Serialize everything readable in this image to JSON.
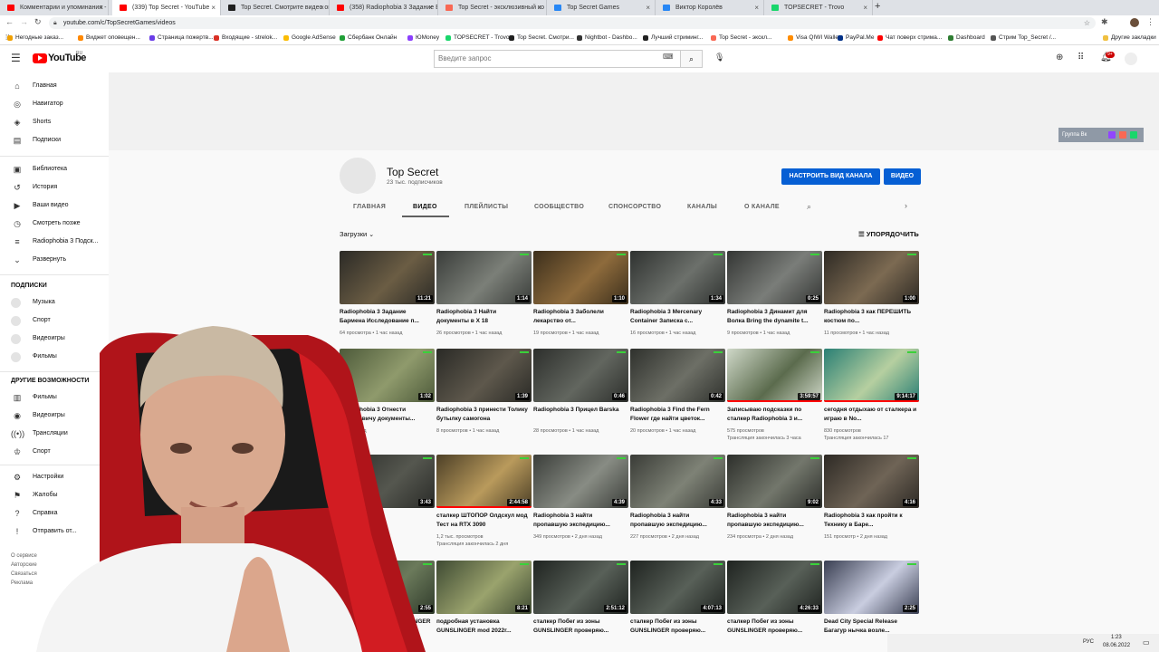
{
  "browser": {
    "tabs": [
      {
        "title": "Комментарии и упоминания -",
        "color": "#ff0000"
      },
      {
        "title": "(339) Top Secret - YouTube",
        "color": "#ff0000"
      },
      {
        "title": "Top Secret. Смотрите видео он",
        "color": "#1f1f1f"
      },
      {
        "title": "(358) Radiophobia 3 Задание Б",
        "color": "#ff0000"
      },
      {
        "title": "Top Secret - эксклюзивный ко",
        "color": "#f96854"
      },
      {
        "title": "Top Secret Games",
        "color": "#2787f5"
      },
      {
        "title": "Виктор Королёв",
        "color": "#2787f5"
      },
      {
        "title": "TOPSECRET - Trovo",
        "color": "#19d66b"
      }
    ],
    "new_tab": "+",
    "url": "youtube.com/c/TopSecretGames/videos",
    "bookmarks": [
      {
        "label": "Негодные заказ...",
        "color": "#f0a000"
      },
      {
        "label": "Виджет оповещен...",
        "color": "#ff8800"
      },
      {
        "label": "Страница пожертв...",
        "color": "#6a3de8"
      },
      {
        "label": "Входящие - strelok...",
        "color": "#d93025"
      },
      {
        "label": "Google AdSense",
        "color": "#fbbc04"
      },
      {
        "label": "Сбербанк Онлайн",
        "color": "#21a038"
      },
      {
        "label": "ЮMoney",
        "color": "#8b3ffd"
      },
      {
        "label": "TOPSECRET - Trovo",
        "color": "#19d66b"
      },
      {
        "label": "Top Secret. Смотри...",
        "color": "#1f1f1f"
      },
      {
        "label": "Nightbot - Dashbo...",
        "color": "#333"
      },
      {
        "label": "Лучший стриминг...",
        "color": "#222"
      },
      {
        "label": "Top Secret - экскл...",
        "color": "#f96854"
      },
      {
        "label": "Visa QIWI Wallet",
        "color": "#ff8c00"
      },
      {
        "label": "PayPal.Me",
        "color": "#003087"
      },
      {
        "label": "Чат поверх стрима...",
        "color": "#ff0000"
      },
      {
        "label": "Dashboard",
        "color": "#2e7d32"
      },
      {
        "label": "Стрим Top_Secret /...",
        "color": "#555"
      }
    ],
    "other_bookmarks": "Другие закладки"
  },
  "youtube": {
    "logo": "YouTube",
    "logo_sup": "RU",
    "search_placeholder": "Введите запрос",
    "notif_count": "9+"
  },
  "sidebar": {
    "main": [
      {
        "label": "Главная",
        "icon": "home-icon",
        "glyph": "⌂"
      },
      {
        "label": "Навигатор",
        "icon": "compass-icon",
        "glyph": "◎"
      },
      {
        "label": "Shorts",
        "icon": "shorts-icon",
        "glyph": "◈"
      },
      {
        "label": "Подписки",
        "icon": "subscriptions-icon",
        "glyph": "▤"
      }
    ],
    "library": [
      {
        "label": "Библиотека",
        "icon": "library-icon",
        "glyph": "▣"
      },
      {
        "label": "История",
        "icon": "history-icon",
        "glyph": "↺"
      },
      {
        "label": "Ваши видео",
        "icon": "your-videos-icon",
        "glyph": "▶"
      },
      {
        "label": "Смотреть позже",
        "icon": "watch-later-icon",
        "glyph": "◷"
      },
      {
        "label": "Radiophobia 3 Подск...",
        "icon": "playlist-icon",
        "glyph": "≡"
      },
      {
        "label": "Развернуть",
        "icon": "chevron-down-icon",
        "glyph": "⌄"
      }
    ],
    "subs_heading": "ПОДПИСКИ",
    "subs": [
      "Музыка",
      "Спорт",
      "Видеоигры",
      "Фильмы"
    ],
    "more_heading": "ДРУГИЕ ВОЗМОЖНОСТИ",
    "more": [
      {
        "label": "Фильмы",
        "icon": "movies-icon",
        "glyph": "▥"
      },
      {
        "label": "Видеоигры",
        "icon": "gaming-icon",
        "glyph": "◉"
      },
      {
        "label": "Трансляции",
        "icon": "live-icon",
        "glyph": "((•))"
      },
      {
        "label": "Спорт",
        "icon": "sports-icon",
        "glyph": "♔"
      }
    ],
    "settings": [
      {
        "label": "Настройки",
        "icon": "gear-icon",
        "glyph": "⚙"
      },
      {
        "label": "Жалобы",
        "icon": "flag-icon",
        "glyph": "⚑"
      },
      {
        "label": "Справка",
        "icon": "help-icon",
        "glyph": "?"
      },
      {
        "label": "Отправить от...",
        "icon": "feedback-icon",
        "glyph": "!"
      }
    ],
    "footer": [
      "О сервисе",
      "Авторские",
      "Связаться",
      "Реклама"
    ]
  },
  "banner": {
    "links_label": "Группа Вк"
  },
  "channel": {
    "name": "Top Secret",
    "subscribers": "23 тыс. подписчиков",
    "customize_button": "НАСТРОИТЬ ВИД КАНАЛА",
    "video_button": "ВИДЕО",
    "tabs": [
      "ГЛАВНАЯ",
      "ВИДЕО",
      "ПЛЕЙЛИСТЫ",
      "СООБЩЕСТВО",
      "СПОНСОРСТВО",
      "КАНАЛЫ",
      "О КАНАЛЕ"
    ],
    "active_tab": "ВИДЕО"
  },
  "filters": {
    "uploads": "Загрузки",
    "sort": "УПОРЯДОЧИТЬ"
  },
  "videos": [
    [
      {
        "title": "Radiophobia 3 Задание Бармена Исследование п...",
        "meta": "64 просмотра • 1 час назад",
        "dur": "11:21",
        "c1": "#2b2a26",
        "c2": "#6b5d44"
      },
      {
        "title": "Radiophobia 3 Найти документы в Х 18",
        "meta": "26 просмотров • 1 час назад",
        "dur": "1:14",
        "c1": "#3a3d3a",
        "c2": "#7b7f78"
      },
      {
        "title": "Radiophobia 3 Заболели лекарство от...",
        "meta": "19 просмотров • 1 час назад",
        "dur": "1:10",
        "c1": "#3c2f1c",
        "c2": "#8e6b3c"
      },
      {
        "title": "Radiophobia 3 Mercenary Container Записка с...",
        "meta": "16 просмотров • 1 час назад",
        "dur": "1:34",
        "c1": "#2f3230",
        "c2": "#6c706b"
      },
      {
        "title": "Radiophobia 3 Динамит для Волка Bring the dynamite t...",
        "meta": "9 просмотров • 1 час назад",
        "dur": "0:25",
        "c1": "#343634",
        "c2": "#7a7d79"
      },
      {
        "title": "Radiophobia 3 как ПЕРЕШИТЬ костюм по...",
        "meta": "11 просмотров • 1 час назад",
        "dur": "1:00",
        "c1": "#2e2a24",
        "c2": "#7c6a52"
      }
    ],
    [
      {
        "title": "Radiophobia 3 Отнести Сидоровичу документы...",
        "meta": "1 час назад",
        "dur": "1:02",
        "c1": "#4d5a3a",
        "c2": "#8f9a6c"
      },
      {
        "title": "Radiophobia 3 принести Толику бутылку самогона",
        "meta": "8 просмотров • 1 час назад",
        "dur": "1:39",
        "c1": "#2a2a26",
        "c2": "#5e584c"
      },
      {
        "title": "Radiophobia 3 Прицел Barska",
        "meta": "28 просмотров • 1 час назад",
        "dur": "0:46",
        "c1": "#2d2f2c",
        "c2": "#62665f"
      },
      {
        "title": "Radiophobia 3 Find the Fern Flower где найти цветок...",
        "meta": "20 просмотров • 1 час назад",
        "dur": "0:42",
        "c1": "#2f312d",
        "c2": "#6d6f66"
      },
      {
        "title": "Записываю подсказки по сталкер Radiophobia 3 и...",
        "meta": "575 просмотров",
        "meta2": "Трансляция закончилась 3 часа",
        "dur": "3:59:57",
        "c1": "#cfd8c8",
        "c2": "#5b6b4d"
      },
      {
        "title": "сегодня отдыхаю от сталкера и играю в No...",
        "meta": "830 просмотров",
        "meta2": "Трансляция закончилась 17",
        "dur": "9:14:17",
        "c1": "#2a7f74",
        "c2": "#b6cfa0"
      }
    ],
    [
      {
        "title": "",
        "meta": "",
        "dur": "3:43",
        "c1": "#2a2b28",
        "c2": "#55574f"
      },
      {
        "title": "сталкер ШТОПОР Олдскул мод Тест на RTX 3090",
        "meta": "1,2 тыс. просмотров",
        "meta2": "Трансляция закончилась 2 дня",
        "dur": "2:44:58",
        "c1": "#4d4027",
        "c2": "#b99a5c"
      },
      {
        "title": "Radiophobia 3 найти пропавшую экспедицию...",
        "meta": "349 просмотров • 2 дня назад",
        "dur": "4:39",
        "c1": "#3b3e3a",
        "c2": "#888c84"
      },
      {
        "title": "Radiophobia 3 найти пропавшую экспедицию...",
        "meta": "227 просмотров • 2 дня назад",
        "dur": "4:33",
        "c1": "#3a3c37",
        "c2": "#7e8276"
      },
      {
        "title": "Radiophobia 3 найти пропавшую экспедицию...",
        "meta": "234 просмотра • 2 дня назад",
        "dur": "9:02",
        "c1": "#2d2f2b",
        "c2": "#73776c"
      },
      {
        "title": "Radiophobia 3 как пройти к Технику в Баре...",
        "meta": "151 просмотр • 2 дня назад",
        "dur": "4:16",
        "c1": "#2e2a25",
        "c2": "#6f6456"
      }
    ],
    [
      {
        "title": "...оны(сваврер) ...GUNSLINGER",
        "meta": "",
        "dur": "2:55",
        "c1": "#2f3a2a",
        "c2": "#6b7a5b"
      },
      {
        "title": "подробная установка GUNSLINGER mod 2022г...",
        "meta": "",
        "dur": "8:21",
        "c1": "#3f4a33",
        "c2": "#9aa36d"
      },
      {
        "title": "сталкер Побег из зоны GUNSLINGER проверяю...",
        "meta": "",
        "dur": "2:51:12",
        "c1": "#1f2320",
        "c2": "#586058"
      },
      {
        "title": "сталкер Побег из зоны GUNSLINGER проверяю...",
        "meta": "",
        "dur": "4:07:13",
        "c1": "#1f2320",
        "c2": "#586058"
      },
      {
        "title": "сталкер Побег из зоны GUNSLINGER проверяю...",
        "meta": "",
        "dur": "4:26:33",
        "c1": "#1f2320",
        "c2": "#586058"
      },
      {
        "title": "Dead City Special Release Багагур нычка возле...",
        "meta": "",
        "dur": "2:25",
        "c1": "#3a3f52",
        "c2": "#c9cde0"
      }
    ]
  ],
  "taskbar": {
    "lang": "РУС",
    "time": "1:23",
    "date": "08.06.2022"
  }
}
